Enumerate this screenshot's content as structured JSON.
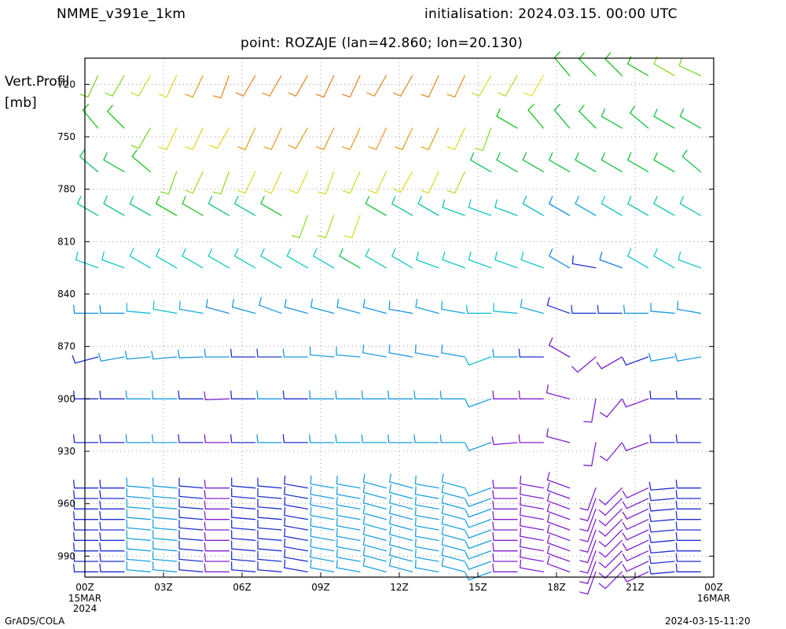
{
  "header": {
    "model": "NMME_v391e_1km",
    "init": "initialisation:  2024.03.15.  00:00  UTC",
    "point": "point:  ROZAJE  (lan=42.860;  lon=20.130)"
  },
  "footer": {
    "left": "GrADS/COLA",
    "right": "2024-03-15-11:20"
  },
  "chart_data": {
    "type": "wind barb vertical profile",
    "ylabel_line1": "Vert.Profil",
    "ylabel_line2": "[mb]",
    "ylim": [
      1000,
      700
    ],
    "y_ticks": [
      "720",
      "750",
      "780",
      "810",
      "840",
      "870",
      "900",
      "930",
      "960",
      "990"
    ],
    "x_ticks": [
      "00Z",
      "03Z",
      "06Z",
      "09Z",
      "12Z",
      "15Z",
      "18Z",
      "21Z",
      "00Z"
    ],
    "x_tick_sub": [
      [
        "15MAR",
        "2024"
      ],
      [],
      [],
      [],
      [],
      [],
      [],
      [],
      [
        "16MAR"
      ]
    ],
    "x_range_hours": [
      0,
      24
    ],
    "grid": true,
    "hours": [
      0.5,
      1.5,
      2.5,
      3.5,
      4.5,
      5.5,
      6.5,
      7.5,
      8.5,
      9.5,
      10.5,
      11.5,
      12.5,
      13.5,
      14.5,
      15.5,
      16.5,
      17.5,
      18.5,
      19.5,
      20.5,
      21.5,
      22.5,
      23.5
    ],
    "levels": [
      {
        "p": 715,
        "dir": [
          205,
          210,
          210,
          205,
          205,
          200,
          210,
          210,
          210,
          205,
          205,
          210,
          210,
          205,
          205,
          210,
          210,
          210,
          320,
          315,
          315,
          300,
          300,
          295
        ],
        "col": [
          "#7ecf2a",
          "#8fd62e",
          "#c8de2e",
          "#e0d82c",
          "#e4a22c",
          "#e8902a",
          "#e0882a",
          "#e0922a",
          "#e0882a",
          "#e08a2a",
          "#e08a2a",
          "#e08e2a",
          "#e08e2a",
          "#e0902a",
          "#e49a2c",
          "#d4da2e",
          "#b4de2e",
          "#e8e02c",
          "#1cbc2c",
          "#1cc02c",
          "#1cbe2c",
          "#2cc02c",
          "#8edc2e",
          "#80d82e"
        ]
      },
      {
        "p": 745,
        "dir": [
          320,
          315,
          210,
          205,
          205,
          210,
          205,
          205,
          210,
          205,
          205,
          205,
          205,
          205,
          205,
          200,
          300,
          320,
          320,
          315,
          300,
          310,
          300,
          300
        ],
        "col": [
          "#1cc21c",
          "#1cc21c",
          "#7edc2a",
          "#e4dc2c",
          "#e0d82c",
          "#e4da2c",
          "#e8a22c",
          "#e8a22c",
          "#e4a22c",
          "#e89e2c",
          "#e89c2c",
          "#e8a02c",
          "#e8a02c",
          "#e4a62c",
          "#dcde2c",
          "#8ede2e",
          "#14c21c",
          "#18c41c",
          "#14b840",
          "#18bc30",
          "#18c040",
          "#18c040",
          "#18c040",
          "#18c040"
        ]
      },
      {
        "p": 770,
        "dir": [
          310,
          300,
          310,
          200,
          205,
          200,
          205,
          205,
          205,
          200,
          205,
          205,
          210,
          205,
          205,
          300,
          300,
          300,
          300,
          300,
          300,
          300,
          300,
          310
        ],
        "col": [
          "#14c060",
          "#18c040",
          "#1cc21c",
          "#7edc2a",
          "#a8de2c",
          "#9ed62c",
          "#e0da2c",
          "#e4da2c",
          "#e4da2c",
          "#d8dc2c",
          "#d4de2c",
          "#d4de2c",
          "#e0da2c",
          "#dadc2c",
          "#b0de2e",
          "#14c060",
          "#14c050",
          "#18c040",
          "#18c040",
          "#18c040",
          "#18c040",
          "#18c040",
          "#18c040",
          "#18c040"
        ]
      },
      {
        "p": 795,
        "dir": [
          300,
          300,
          300,
          300,
          300,
          300,
          300,
          300,
          200,
          200,
          200,
          300,
          300,
          300,
          290,
          290,
          290,
          300,
          300,
          300,
          300,
          300,
          300,
          300
        ],
        "col": [
          "#14c496",
          "#1cc878",
          "#1cc878",
          "#1cc21c",
          "#38c232",
          "#24c480",
          "#18c496",
          "#28c240",
          "#8ede2e",
          "#a8e02c",
          "#e0da2c",
          "#28c240",
          "#14c496",
          "#14c4a0",
          "#14c4b0",
          "#14c8c0",
          "#14c8b8",
          "#14b8d0",
          "#1c90e0",
          "#1ca8e0",
          "#1cc4c8",
          "#1cc4b0",
          "#1cc4b0",
          "#1cc4b0"
        ]
      },
      {
        "p": 825,
        "dir": [
          290,
          290,
          300,
          300,
          300,
          300,
          300,
          300,
          300,
          300,
          300,
          300,
          300,
          290,
          290,
          290,
          290,
          290,
          300,
          280,
          290,
          300,
          300,
          290
        ],
        "col": [
          "#14c8c8",
          "#14c8c8",
          "#14c8c8",
          "#14c8b8",
          "#14c8b8",
          "#14c8b8",
          "#14c8b8",
          "#14c8c0",
          "#14c8c0",
          "#14c8c0",
          "#18c050",
          "#14c8c0",
          "#14c8c0",
          "#14c8c0",
          "#14c8c8",
          "#14c8c8",
          "#14c8c8",
          "#14c8c8",
          "#1c90e0",
          "#2030d0",
          "#1c80e0",
          "#14c8c8",
          "#14c8c8",
          "#14c8c8"
        ]
      },
      {
        "p": 851,
        "dir": [
          270,
          270,
          275,
          280,
          280,
          285,
          285,
          290,
          285,
          285,
          285,
          285,
          280,
          285,
          280,
          270,
          275,
          285,
          290,
          270,
          270,
          270,
          275,
          280
        ],
        "col": [
          "#1c98e0",
          "#1c90e0",
          "#1cb8e0",
          "#14c8c8",
          "#1ca8e0",
          "#1c90e0",
          "#1c98e0",
          "#1c98e0",
          "#1c98e0",
          "#1c98e0",
          "#1c98e0",
          "#1c98e0",
          "#1c98e0",
          "#1ca0e0",
          "#1ca8e0",
          "#14c0d0",
          "#14c0d0",
          "#1ca8e0",
          "#2030d0",
          "#2038d0",
          "#2040d0",
          "#1c98e0",
          "#1c98e0",
          "#1c98e0"
        ]
      },
      {
        "p": 876,
        "dir": [
          255,
          260,
          265,
          265,
          268,
          270,
          270,
          270,
          270,
          275,
          275,
          280,
          280,
          280,
          280,
          250,
          270,
          270,
          300,
          230,
          240,
          250,
          260,
          260
        ],
        "col": [
          "#2030d0",
          "#1c98e0",
          "#1c98e0",
          "#1c98e0",
          "#1c98e0",
          "#1c98e0",
          "#2030d0",
          "#2040d0",
          "#1c98e0",
          "#1c98e0",
          "#1ca0e0",
          "#1ca0e0",
          "#1c98e0",
          "#1c98e0",
          "#1c98e0",
          "#14c0d0",
          "#1c98e0",
          "#2030d0",
          "#8020d0",
          "#8020d0",
          "#8020d0",
          "#2030d0",
          "#1c98e0",
          "#1c98e0"
        ]
      },
      {
        "p": 900,
        "dir": [
          270,
          270,
          270,
          270,
          270,
          268,
          270,
          270,
          270,
          270,
          270,
          270,
          270,
          270,
          270,
          250,
          270,
          270,
          285,
          190,
          220,
          250,
          270,
          270
        ],
        "col": [
          "#2030d0",
          "#2030d0",
          "#1c98e0",
          "#1ca0e0",
          "#2030d0",
          "#8020d0",
          "#2030d0",
          "#1c98e0",
          "#2030d0",
          "#1c98e0",
          "#1ca0e0",
          "#1ca0e0",
          "#1c98e0",
          "#1ca0e0",
          "#1ca0e0",
          "#1ca0e0",
          "#8020d0",
          "#8020d0",
          "#8020d0",
          "#8020d0",
          "#8020d0",
          "#8020d0",
          "#2030d0",
          "#2030d0"
        ]
      },
      {
        "p": 925,
        "dir": [
          270,
          270,
          270,
          270,
          270,
          270,
          270,
          270,
          270,
          270,
          270,
          270,
          270,
          270,
          270,
          250,
          265,
          270,
          285,
          190,
          220,
          250,
          270,
          270
        ],
        "col": [
          "#2030d0",
          "#2030d0",
          "#1c98e0",
          "#1ca0e0",
          "#2030d0",
          "#8020d0",
          "#2030d0",
          "#1c98e0",
          "#2030d0",
          "#1c98e0",
          "#1ca0e0",
          "#1ca0e0",
          "#1c98e0",
          "#1ca0e0",
          "#1ca0e0",
          "#1ca0e0",
          "#8020d0",
          "#8020d0",
          "#8020d0",
          "#8020d0",
          "#8020d0",
          "#8020d0",
          "#2030d0",
          "#2030d0"
        ]
      },
      {
        "p": 951,
        "dir": [
          270,
          270,
          275,
          275,
          275,
          270,
          275,
          275,
          280,
          280,
          280,
          285,
          285,
          280,
          285,
          250,
          270,
          280,
          290,
          200,
          225,
          245,
          265,
          270
        ],
        "col": [
          "#2030d0",
          "#2030d0",
          "#1ca0e0",
          "#1ca0e0",
          "#2030d0",
          "#8020d0",
          "#2030d0",
          "#2030d0",
          "#2030d0",
          "#1ca0e0",
          "#1ca0e0",
          "#1ca0e0",
          "#1ca0e0",
          "#1ca0e0",
          "#1ca0e0",
          "#1ca0e0",
          "#8020d0",
          "#8020d0",
          "#8020d0",
          "#8020d0",
          "#8020d0",
          "#8020d0",
          "#2030d0",
          "#2030d0"
        ]
      },
      {
        "p": 957,
        "dir": [
          270,
          270,
          275,
          275,
          275,
          270,
          275,
          275,
          280,
          280,
          280,
          285,
          285,
          280,
          285,
          250,
          270,
          280,
          290,
          200,
          225,
          245,
          265,
          270
        ],
        "col": [
          "#2030d0",
          "#2030d0",
          "#1ca0e0",
          "#1ca0e0",
          "#2030d0",
          "#8020d0",
          "#2030d0",
          "#2030d0",
          "#2030d0",
          "#1ca0e0",
          "#1ca0e0",
          "#1ca0e0",
          "#1ca0e0",
          "#1ca0e0",
          "#1ca0e0",
          "#1ca0e0",
          "#8020d0",
          "#8020d0",
          "#8020d0",
          "#8020d0",
          "#8020d0",
          "#8020d0",
          "#2030d0",
          "#2030d0"
        ]
      },
      {
        "p": 963,
        "dir": [
          270,
          270,
          275,
          275,
          275,
          270,
          275,
          275,
          280,
          280,
          280,
          285,
          285,
          280,
          285,
          250,
          270,
          280,
          290,
          200,
          225,
          245,
          265,
          270
        ],
        "col": [
          "#2030d0",
          "#2030d0",
          "#1ca0e0",
          "#1ca0e0",
          "#2030d0",
          "#8020d0",
          "#2030d0",
          "#2030d0",
          "#2030d0",
          "#1ca0e0",
          "#1ca0e0",
          "#1ca0e0",
          "#1ca0e0",
          "#1ca0e0",
          "#1ca0e0",
          "#1ca0e0",
          "#8020d0",
          "#8020d0",
          "#8020d0",
          "#8020d0",
          "#8020d0",
          "#8020d0",
          "#2030d0",
          "#2030d0"
        ]
      },
      {
        "p": 969,
        "dir": [
          270,
          270,
          275,
          275,
          275,
          270,
          275,
          275,
          280,
          280,
          280,
          285,
          285,
          280,
          285,
          250,
          270,
          280,
          290,
          200,
          225,
          245,
          265,
          270
        ],
        "col": [
          "#2030d0",
          "#2030d0",
          "#1ca0e0",
          "#1ca0e0",
          "#2030d0",
          "#8020d0",
          "#2030d0",
          "#2030d0",
          "#2030d0",
          "#1ca0e0",
          "#1ca0e0",
          "#1ca0e0",
          "#1ca0e0",
          "#1ca0e0",
          "#1ca0e0",
          "#1ca0e0",
          "#8020d0",
          "#8020d0",
          "#8020d0",
          "#8020d0",
          "#8020d0",
          "#8020d0",
          "#2030d0",
          "#2030d0"
        ]
      },
      {
        "p": 975,
        "dir": [
          270,
          270,
          275,
          275,
          275,
          270,
          275,
          275,
          280,
          280,
          280,
          285,
          285,
          280,
          285,
          250,
          270,
          280,
          290,
          200,
          225,
          245,
          265,
          270
        ],
        "col": [
          "#2030d0",
          "#2030d0",
          "#1ca0e0",
          "#1ca0e0",
          "#2030d0",
          "#8020d0",
          "#2030d0",
          "#2030d0",
          "#2030d0",
          "#1ca0e0",
          "#1ca0e0",
          "#1ca0e0",
          "#1ca0e0",
          "#1ca0e0",
          "#1ca0e0",
          "#1ca0e0",
          "#8020d0",
          "#8020d0",
          "#8020d0",
          "#8020d0",
          "#8020d0",
          "#8020d0",
          "#2030d0",
          "#2030d0"
        ]
      },
      {
        "p": 981,
        "dir": [
          270,
          270,
          275,
          275,
          275,
          270,
          275,
          275,
          280,
          280,
          280,
          285,
          285,
          280,
          285,
          250,
          270,
          280,
          290,
          200,
          225,
          245,
          265,
          270
        ],
        "col": [
          "#2030d0",
          "#2030d0",
          "#1ca0e0",
          "#1ca0e0",
          "#2030d0",
          "#8020d0",
          "#2030d0",
          "#2030d0",
          "#2030d0",
          "#1ca0e0",
          "#1ca0e0",
          "#1ca0e0",
          "#1ca0e0",
          "#1ca0e0",
          "#1ca0e0",
          "#1ca0e0",
          "#8020d0",
          "#8020d0",
          "#8020d0",
          "#8020d0",
          "#8020d0",
          "#8020d0",
          "#2030d0",
          "#2030d0"
        ]
      },
      {
        "p": 987,
        "dir": [
          270,
          270,
          275,
          275,
          275,
          270,
          275,
          275,
          280,
          280,
          280,
          285,
          285,
          280,
          285,
          250,
          270,
          280,
          290,
          200,
          225,
          245,
          265,
          270
        ],
        "col": [
          "#2030d0",
          "#2030d0",
          "#1ca0e0",
          "#1ca0e0",
          "#2030d0",
          "#8020d0",
          "#2030d0",
          "#2030d0",
          "#2030d0",
          "#1ca0e0",
          "#1ca0e0",
          "#1ca0e0",
          "#1ca0e0",
          "#1ca0e0",
          "#1ca0e0",
          "#1ca0e0",
          "#8020d0",
          "#8020d0",
          "#8020d0",
          "#8020d0",
          "#8020d0",
          "#8020d0",
          "#2030d0",
          "#2030d0"
        ]
      },
      {
        "p": 993,
        "dir": [
          270,
          270,
          275,
          275,
          275,
          270,
          275,
          275,
          280,
          280,
          280,
          285,
          285,
          280,
          285,
          250,
          270,
          280,
          290,
          200,
          225,
          245,
          265,
          270
        ],
        "col": [
          "#2030d0",
          "#2030d0",
          "#1ca0e0",
          "#1ca0e0",
          "#2030d0",
          "#8020d0",
          "#2030d0",
          "#2030d0",
          "#2030d0",
          "#1ca0e0",
          "#1ca0e0",
          "#1ca0e0",
          "#1ca0e0",
          "#1ca0e0",
          "#1ca0e0",
          "#1ca0e0",
          "#8020d0",
          "#8020d0",
          "#8020d0",
          "#8020d0",
          "#8020d0",
          "#8020d0",
          "#2030d0",
          "#2030d0"
        ]
      },
      {
        "p": 999,
        "dir": [
          270,
          270,
          275,
          275,
          275,
          270,
          275,
          275,
          280,
          280,
          280,
          285,
          285,
          280,
          285,
          250,
          270,
          280,
          290,
          200,
          225,
          245,
          265,
          270
        ],
        "col": [
          "#2030d0",
          "#2030d0",
          "#1ca0e0",
          "#1ca0e0",
          "#2030d0",
          "#8020d0",
          "#2030d0",
          "#2030d0",
          "#2030d0",
          "#1ca0e0",
          "#1ca0e0",
          "#1ca0e0",
          "#1ca0e0",
          "#1ca0e0",
          "#1ca0e0",
          "#1ca0e0",
          "#8020d0",
          "#8020d0",
          "#8020d0",
          "#8020d0",
          "#8020d0",
          "#8020d0",
          "#2030d0",
          "#2030d0"
        ]
      }
    ]
  }
}
